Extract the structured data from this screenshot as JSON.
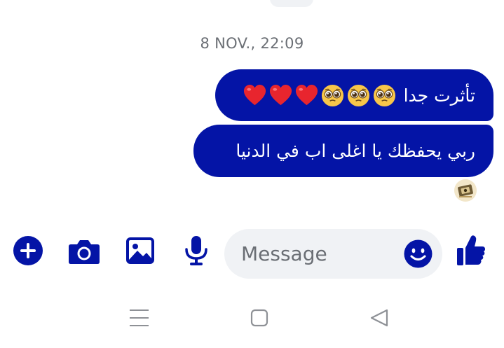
{
  "conversation": {
    "timestamp": "8 NOV., 22:09",
    "messages": [
      {
        "text": "تأثرت جدا",
        "emojis": [
          "pleading-face",
          "pleading-face",
          "pleading-face",
          "red-heart",
          "red-heart",
          "red-heart"
        ]
      },
      {
        "text": "ربي يحفظك يا اغلى اب في الدنيا",
        "emojis": []
      }
    ]
  },
  "composer": {
    "placeholder": "Message",
    "icons": [
      "plus-icon",
      "camera-icon",
      "image-icon",
      "microphone-icon",
      "emoji-icon",
      "thumbs-up-icon"
    ]
  },
  "navigation": {
    "icons": [
      "recents-icon",
      "home-icon",
      "back-icon"
    ]
  },
  "colors": {
    "bubble": "#0414a6",
    "accent": "#0414a6",
    "timestamp": "#6b6f75",
    "input_background": "#f0f2f5"
  }
}
